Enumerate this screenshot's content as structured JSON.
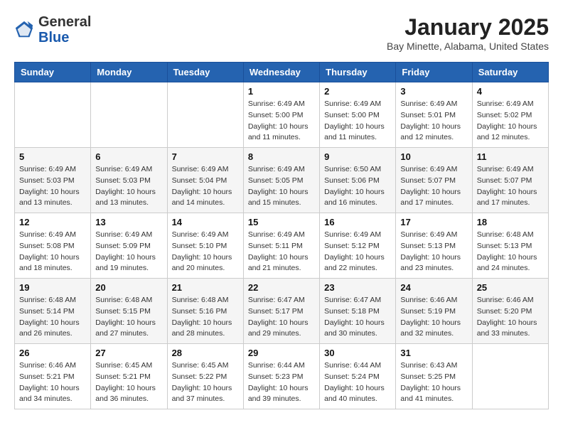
{
  "header": {
    "logo_general": "General",
    "logo_blue": "Blue",
    "month_year": "January 2025",
    "location": "Bay Minette, Alabama, United States"
  },
  "weekdays": [
    "Sunday",
    "Monday",
    "Tuesday",
    "Wednesday",
    "Thursday",
    "Friday",
    "Saturday"
  ],
  "weeks": [
    [
      {
        "day": "",
        "sunrise": "",
        "sunset": "",
        "daylight": ""
      },
      {
        "day": "",
        "sunrise": "",
        "sunset": "",
        "daylight": ""
      },
      {
        "day": "",
        "sunrise": "",
        "sunset": "",
        "daylight": ""
      },
      {
        "day": "1",
        "sunrise": "Sunrise: 6:49 AM",
        "sunset": "Sunset: 5:00 PM",
        "daylight": "Daylight: 10 hours and 11 minutes."
      },
      {
        "day": "2",
        "sunrise": "Sunrise: 6:49 AM",
        "sunset": "Sunset: 5:00 PM",
        "daylight": "Daylight: 10 hours and 11 minutes."
      },
      {
        "day": "3",
        "sunrise": "Sunrise: 6:49 AM",
        "sunset": "Sunset: 5:01 PM",
        "daylight": "Daylight: 10 hours and 12 minutes."
      },
      {
        "day": "4",
        "sunrise": "Sunrise: 6:49 AM",
        "sunset": "Sunset: 5:02 PM",
        "daylight": "Daylight: 10 hours and 12 minutes."
      }
    ],
    [
      {
        "day": "5",
        "sunrise": "Sunrise: 6:49 AM",
        "sunset": "Sunset: 5:03 PM",
        "daylight": "Daylight: 10 hours and 13 minutes."
      },
      {
        "day": "6",
        "sunrise": "Sunrise: 6:49 AM",
        "sunset": "Sunset: 5:03 PM",
        "daylight": "Daylight: 10 hours and 13 minutes."
      },
      {
        "day": "7",
        "sunrise": "Sunrise: 6:49 AM",
        "sunset": "Sunset: 5:04 PM",
        "daylight": "Daylight: 10 hours and 14 minutes."
      },
      {
        "day": "8",
        "sunrise": "Sunrise: 6:49 AM",
        "sunset": "Sunset: 5:05 PM",
        "daylight": "Daylight: 10 hours and 15 minutes."
      },
      {
        "day": "9",
        "sunrise": "Sunrise: 6:50 AM",
        "sunset": "Sunset: 5:06 PM",
        "daylight": "Daylight: 10 hours and 16 minutes."
      },
      {
        "day": "10",
        "sunrise": "Sunrise: 6:49 AM",
        "sunset": "Sunset: 5:07 PM",
        "daylight": "Daylight: 10 hours and 17 minutes."
      },
      {
        "day": "11",
        "sunrise": "Sunrise: 6:49 AM",
        "sunset": "Sunset: 5:07 PM",
        "daylight": "Daylight: 10 hours and 17 minutes."
      }
    ],
    [
      {
        "day": "12",
        "sunrise": "Sunrise: 6:49 AM",
        "sunset": "Sunset: 5:08 PM",
        "daylight": "Daylight: 10 hours and 18 minutes."
      },
      {
        "day": "13",
        "sunrise": "Sunrise: 6:49 AM",
        "sunset": "Sunset: 5:09 PM",
        "daylight": "Daylight: 10 hours and 19 minutes."
      },
      {
        "day": "14",
        "sunrise": "Sunrise: 6:49 AM",
        "sunset": "Sunset: 5:10 PM",
        "daylight": "Daylight: 10 hours and 20 minutes."
      },
      {
        "day": "15",
        "sunrise": "Sunrise: 6:49 AM",
        "sunset": "Sunset: 5:11 PM",
        "daylight": "Daylight: 10 hours and 21 minutes."
      },
      {
        "day": "16",
        "sunrise": "Sunrise: 6:49 AM",
        "sunset": "Sunset: 5:12 PM",
        "daylight": "Daylight: 10 hours and 22 minutes."
      },
      {
        "day": "17",
        "sunrise": "Sunrise: 6:49 AM",
        "sunset": "Sunset: 5:13 PM",
        "daylight": "Daylight: 10 hours and 23 minutes."
      },
      {
        "day": "18",
        "sunrise": "Sunrise: 6:48 AM",
        "sunset": "Sunset: 5:13 PM",
        "daylight": "Daylight: 10 hours and 24 minutes."
      }
    ],
    [
      {
        "day": "19",
        "sunrise": "Sunrise: 6:48 AM",
        "sunset": "Sunset: 5:14 PM",
        "daylight": "Daylight: 10 hours and 26 minutes."
      },
      {
        "day": "20",
        "sunrise": "Sunrise: 6:48 AM",
        "sunset": "Sunset: 5:15 PM",
        "daylight": "Daylight: 10 hours and 27 minutes."
      },
      {
        "day": "21",
        "sunrise": "Sunrise: 6:48 AM",
        "sunset": "Sunset: 5:16 PM",
        "daylight": "Daylight: 10 hours and 28 minutes."
      },
      {
        "day": "22",
        "sunrise": "Sunrise: 6:47 AM",
        "sunset": "Sunset: 5:17 PM",
        "daylight": "Daylight: 10 hours and 29 minutes."
      },
      {
        "day": "23",
        "sunrise": "Sunrise: 6:47 AM",
        "sunset": "Sunset: 5:18 PM",
        "daylight": "Daylight: 10 hours and 30 minutes."
      },
      {
        "day": "24",
        "sunrise": "Sunrise: 6:46 AM",
        "sunset": "Sunset: 5:19 PM",
        "daylight": "Daylight: 10 hours and 32 minutes."
      },
      {
        "day": "25",
        "sunrise": "Sunrise: 6:46 AM",
        "sunset": "Sunset: 5:20 PM",
        "daylight": "Daylight: 10 hours and 33 minutes."
      }
    ],
    [
      {
        "day": "26",
        "sunrise": "Sunrise: 6:46 AM",
        "sunset": "Sunset: 5:21 PM",
        "daylight": "Daylight: 10 hours and 34 minutes."
      },
      {
        "day": "27",
        "sunrise": "Sunrise: 6:45 AM",
        "sunset": "Sunset: 5:21 PM",
        "daylight": "Daylight: 10 hours and 36 minutes."
      },
      {
        "day": "28",
        "sunrise": "Sunrise: 6:45 AM",
        "sunset": "Sunset: 5:22 PM",
        "daylight": "Daylight: 10 hours and 37 minutes."
      },
      {
        "day": "29",
        "sunrise": "Sunrise: 6:44 AM",
        "sunset": "Sunset: 5:23 PM",
        "daylight": "Daylight: 10 hours and 39 minutes."
      },
      {
        "day": "30",
        "sunrise": "Sunrise: 6:44 AM",
        "sunset": "Sunset: 5:24 PM",
        "daylight": "Daylight: 10 hours and 40 minutes."
      },
      {
        "day": "31",
        "sunrise": "Sunrise: 6:43 AM",
        "sunset": "Sunset: 5:25 PM",
        "daylight": "Daylight: 10 hours and 41 minutes."
      },
      {
        "day": "",
        "sunrise": "",
        "sunset": "",
        "daylight": ""
      }
    ]
  ]
}
